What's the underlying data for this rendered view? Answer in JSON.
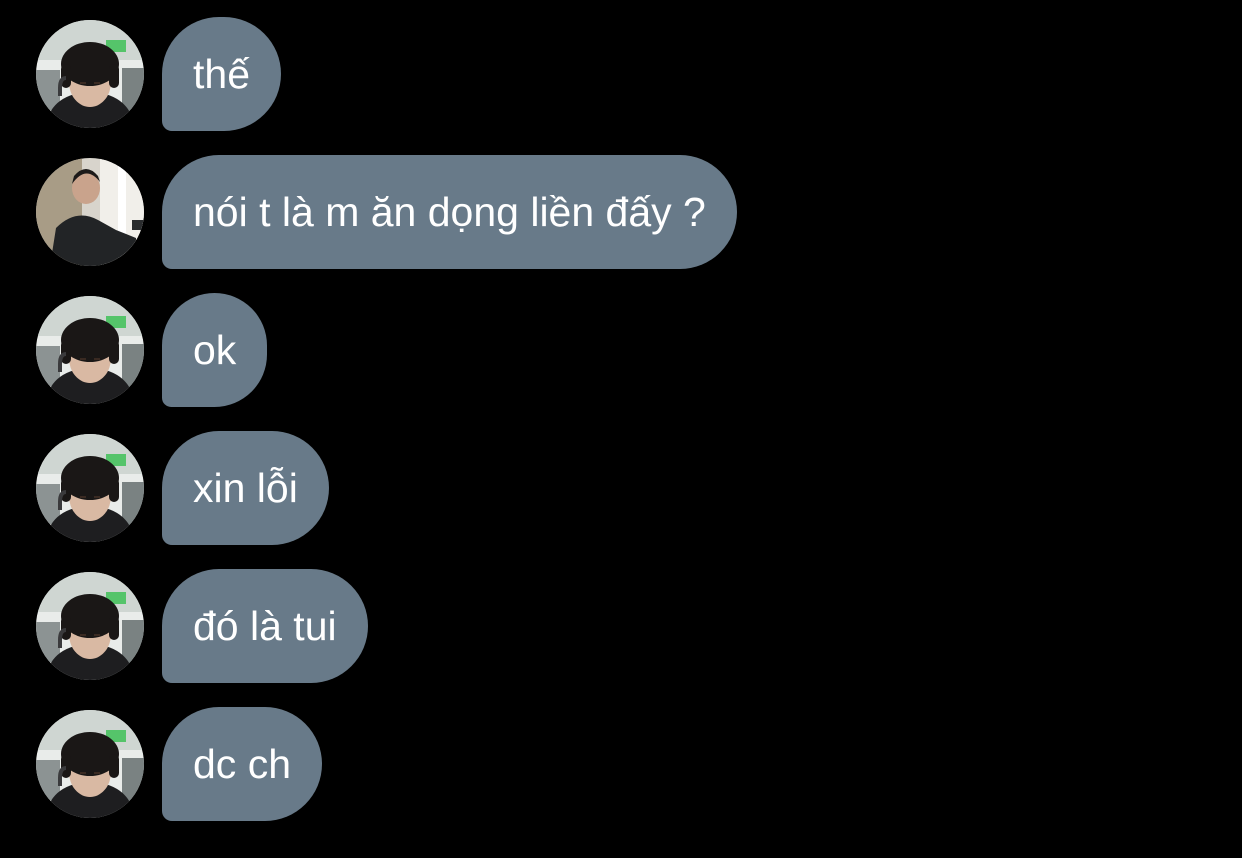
{
  "colors": {
    "background": "#000000",
    "bubble": "#687a89",
    "text": "#ffffff"
  },
  "messages": [
    {
      "sender": "user-a",
      "text": "thế"
    },
    {
      "sender": "user-b",
      "text": "nói t là m ăn dọng liền đấy ?"
    },
    {
      "sender": "user-a",
      "text": "ok"
    },
    {
      "sender": "user-a",
      "text": "xin lỗi"
    },
    {
      "sender": "user-a",
      "text": "đó là tui"
    },
    {
      "sender": "user-a",
      "text": "dc ch"
    }
  ]
}
